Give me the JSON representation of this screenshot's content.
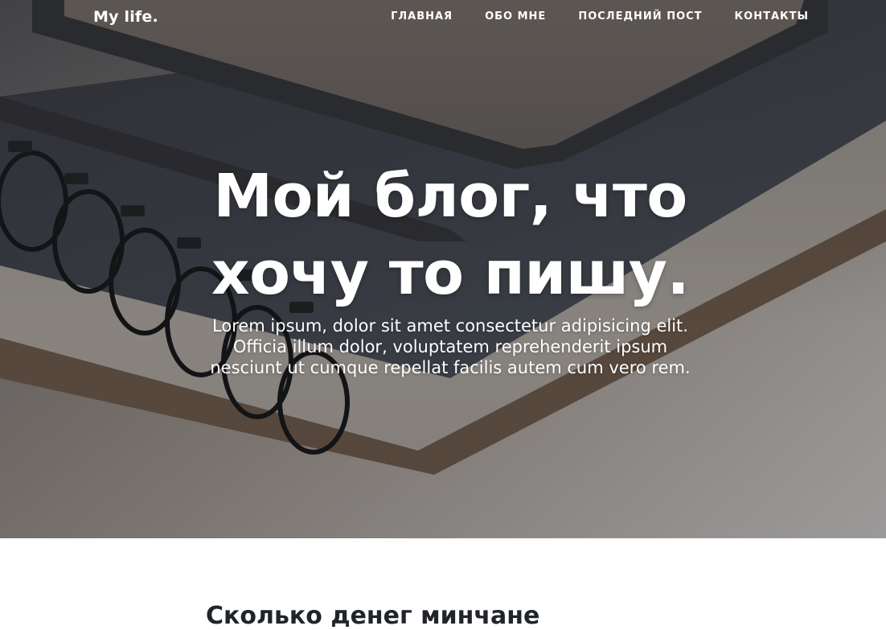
{
  "nav": {
    "brand": "My life.",
    "items": [
      {
        "label": "ГЛАВНАЯ"
      },
      {
        "label": "ОБО МНЕ"
      },
      {
        "label": "ПОСЛЕДНИЙ ПОСТ"
      },
      {
        "label": "КОНТАКТЫ"
      }
    ]
  },
  "hero": {
    "title_line1": "Мой блог, что",
    "title_line2": "хочу то пишу.",
    "subtitle_line1": "Lorem ipsum, dolor sit amet consectetur adipisicing elit.",
    "subtitle_line2": "Officia illum dolor, voluptatem reprehenderit ipsum",
    "subtitle_line3": "nesciunt ut cumque repellat facilis autem cum vero rem."
  },
  "post": {
    "title": "Сколько денег минчане"
  }
}
